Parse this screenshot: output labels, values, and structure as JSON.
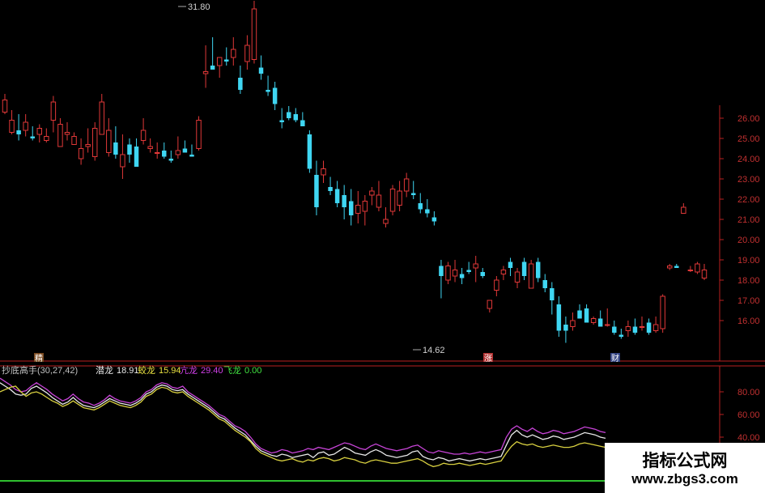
{
  "chart_data": [
    {
      "type": "candlestick",
      "y_range": [
        14.0,
        32.3
      ],
      "y_ticks": [
        "26.00",
        "25.00",
        "24.00",
        "23.00",
        "22.00",
        "21.00",
        "20.00",
        "19.00",
        "18.00",
        "17.00",
        "16.00"
      ],
      "markers": {
        "high": "31.80",
        "low": "14.62",
        "event_1": "精",
        "event_2": "涨",
        "event_3": "财"
      },
      "colors": {
        "up": "#e03838",
        "down": "#3fd6f2",
        "axis": "#b82020"
      },
      "candles": [
        [
          26.3,
          27.2,
          26.2,
          26.9
        ],
        [
          25.3,
          26.4,
          25.2,
          25.9
        ],
        [
          25.4,
          26.2,
          24.9,
          25.2
        ],
        [
          25.4,
          26.2,
          25.1,
          25.8
        ],
        [
          25.1,
          25.6,
          24.9,
          25.0
        ],
        [
          25.2,
          25.7,
          24.8,
          25.5
        ],
        [
          24.9,
          25.5,
          24.8,
          25.1
        ],
        [
          25.9,
          27.1,
          25.3,
          26.8
        ],
        [
          24.6,
          26.0,
          24.7,
          25.7
        ],
        [
          25.2,
          25.8,
          24.9,
          25.3
        ],
        [
          24.7,
          25.3,
          24.7,
          25.1
        ],
        [
          24.0,
          25.0,
          23.7,
          24.5
        ],
        [
          24.6,
          25.5,
          24.3,
          24.7
        ],
        [
          24.1,
          25.8,
          23.9,
          25.5
        ],
        [
          25.2,
          27.2,
          26.0,
          26.8
        ],
        [
          24.3,
          26.0,
          24.1,
          25.4
        ],
        [
          24.8,
          25.6,
          24.0,
          24.2
        ],
        [
          23.6,
          25.2,
          23.0,
          24.2
        ],
        [
          24.7,
          25.0,
          23.8,
          24.2
        ],
        [
          24.6,
          25.0,
          23.6,
          23.6
        ],
        [
          24.9,
          26.0,
          24.7,
          25.4
        ],
        [
          24.5,
          25.0,
          24.3,
          24.6
        ],
        [
          24.3,
          24.8,
          24.0,
          24.3
        ],
        [
          24.4,
          24.8,
          24.0,
          24.1
        ],
        [
          24.0,
          24.4,
          23.8,
          23.9
        ],
        [
          24.2,
          25.1,
          24.0,
          24.4
        ],
        [
          24.5,
          24.9,
          24.3,
          24.3
        ],
        [
          24.2,
          24.7,
          24.1,
          24.1
        ],
        [
          24.5,
          26.1,
          24.4,
          25.9
        ],
        [
          28.2,
          29.6,
          27.5,
          28.3
        ],
        [
          28.6,
          30.0,
          28.4,
          28.4
        ],
        [
          28.6,
          29.0,
          28.0,
          29.0
        ],
        [
          28.9,
          29.5,
          28.6,
          28.8
        ],
        [
          29.0,
          30.0,
          28.6,
          29.4
        ],
        [
          28.0,
          28.6,
          27.2,
          27.4
        ],
        [
          28.8,
          30.1,
          28.4,
          29.6
        ],
        [
          28.9,
          31.8,
          28.7,
          31.4
        ],
        [
          28.5,
          29.1,
          27.9,
          28.2
        ],
        [
          27.4,
          28.1,
          27.1,
          27.3
        ],
        [
          27.5,
          27.8,
          26.4,
          26.7
        ],
        [
          25.9,
          26.5,
          25.5,
          25.8
        ],
        [
          26.3,
          26.6,
          25.9,
          26.0
        ],
        [
          26.2,
          26.5,
          25.8,
          25.9
        ],
        [
          25.9,
          26.3,
          25.6,
          25.6
        ],
        [
          25.2,
          25.4,
          23.3,
          23.5
        ],
        [
          23.2,
          23.9,
          21.2,
          21.6
        ],
        [
          23.2,
          23.9,
          22.8,
          23.5
        ],
        [
          22.6,
          23.1,
          22.2,
          22.4
        ],
        [
          22.5,
          22.9,
          21.6,
          21.8
        ],
        [
          22.2,
          22.7,
          21.0,
          21.6
        ],
        [
          21.9,
          22.5,
          20.7,
          21.2
        ],
        [
          21.3,
          22.4,
          20.8,
          21.7
        ],
        [
          21.4,
          22.2,
          20.7,
          21.9
        ],
        [
          22.2,
          22.6,
          21.7,
          22.4
        ],
        [
          21.6,
          22.9,
          21.4,
          22.2
        ],
        [
          20.8,
          21.6,
          20.6,
          21.0
        ],
        [
          21.4,
          22.7,
          21.2,
          22.5
        ],
        [
          21.7,
          22.9,
          21.4,
          22.4
        ],
        [
          22.4,
          23.3,
          22.1,
          23.0
        ],
        [
          22.3,
          22.9,
          22.0,
          22.2
        ],
        [
          21.8,
          22.3,
          21.3,
          21.5
        ],
        [
          21.5,
          22.0,
          21.1,
          21.3
        ],
        [
          21.1,
          21.4,
          20.7,
          20.9
        ],
        [
          18.7,
          19.0,
          17.1,
          18.2
        ],
        [
          18.0,
          18.9,
          17.8,
          18.7
        ],
        [
          18.2,
          19.0,
          17.9,
          18.5
        ],
        [
          18.3,
          18.6,
          17.8,
          18.1
        ],
        [
          18.5,
          18.9,
          18.3,
          18.4
        ],
        [
          18.6,
          19.2,
          17.9,
          18.8
        ],
        [
          18.4,
          18.6,
          18.1,
          18.2
        ],
        [
          16.6,
          17.0,
          16.4,
          17.0
        ],
        [
          17.5,
          18.2,
          17.2,
          18.0
        ],
        [
          18.3,
          18.7,
          18.0,
          18.5
        ],
        [
          18.9,
          19.1,
          18.2,
          18.6
        ],
        [
          17.9,
          18.6,
          17.6,
          18.4
        ],
        [
          18.9,
          19.1,
          18.0,
          18.2
        ],
        [
          17.6,
          19.0,
          17.6,
          18.8
        ],
        [
          18.9,
          19.1,
          17.9,
          18.1
        ],
        [
          18.0,
          18.3,
          17.4,
          17.6
        ],
        [
          17.6,
          17.9,
          16.3,
          17.0
        ],
        [
          16.8,
          17.2,
          15.2,
          15.5
        ],
        [
          15.8,
          16.2,
          14.9,
          15.5
        ],
        [
          15.7,
          16.4,
          15.5,
          16.0
        ],
        [
          16.5,
          16.8,
          16.1,
          16.1
        ],
        [
          16.6,
          16.8,
          15.9,
          15.9
        ],
        [
          15.9,
          16.2,
          15.8,
          16.1
        ],
        [
          16.1,
          16.5,
          15.7,
          15.7
        ],
        [
          15.8,
          16.6,
          15.7,
          15.8
        ],
        [
          15.7,
          16.0,
          15.3,
          15.4
        ],
        [
          15.3,
          15.6,
          15.1,
          15.2
        ],
        [
          15.5,
          16.0,
          15.2,
          15.7
        ],
        [
          15.7,
          16.1,
          15.3,
          15.4
        ],
        [
          15.7,
          16.2,
          15.5,
          15.7
        ],
        [
          15.9,
          16.1,
          15.3,
          15.4
        ],
        [
          15.5,
          16.2,
          15.4,
          15.8
        ],
        [
          15.6,
          17.3,
          15.4,
          17.2
        ],
        [
          18.6,
          18.8,
          18.5,
          18.7
        ],
        [
          18.7,
          18.8,
          18.6,
          18.6
        ],
        [
          21.3,
          21.8,
          21.4,
          21.6
        ],
        [
          18.5,
          18.7,
          18.4,
          18.5
        ],
        [
          18.4,
          18.9,
          18.3,
          18.8
        ],
        [
          18.1,
          18.8,
          18.0,
          18.5
        ]
      ]
    },
    {
      "type": "line",
      "title": "抄底高手(30,27,42)",
      "ylim": [
        0,
        100
      ],
      "y_ticks": [
        "80.00",
        "60.00",
        "40.00"
      ],
      "legend": [
        {
          "name": "潜龙",
          "value": "18.91",
          "color": "#e8e8e8"
        },
        {
          "name": "蛟龙",
          "value": "15.94",
          "color": "#e8e040"
        },
        {
          "name": "亢龙",
          "value": "29.40",
          "color": "#d040e8"
        },
        {
          "name": "飞龙",
          "value": "0.00",
          "color": "#40e040"
        }
      ],
      "series": [
        {
          "name": "亢龙",
          "color": "#c844d8",
          "values": [
            92,
            89,
            86,
            82,
            80,
            81,
            85,
            88,
            85,
            82,
            78,
            75,
            72,
            74,
            78,
            74,
            71,
            70,
            68,
            70,
            73,
            77,
            74,
            72,
            71,
            70,
            72,
            75,
            80,
            82,
            86,
            88,
            87,
            84,
            83,
            85,
            80,
            77,
            74,
            71,
            68,
            64,
            60,
            58,
            54,
            50,
            48,
            45,
            40,
            34,
            30,
            28,
            26,
            27,
            29,
            28,
            26,
            27,
            28,
            30,
            29,
            31,
            30,
            29,
            31,
            33,
            35,
            34,
            32,
            30,
            29,
            32,
            34,
            32,
            30,
            29,
            28,
            29,
            30,
            32,
            33,
            30,
            27,
            26,
            28,
            27,
            26,
            25,
            25,
            26,
            25,
            26,
            27,
            26,
            27,
            28,
            29,
            40,
            47,
            50,
            47,
            45,
            48,
            45,
            43,
            44,
            46,
            45,
            43,
            44,
            45,
            47,
            49,
            48,
            47,
            45,
            44
          ]
        },
        {
          "name": "潜龙",
          "color": "#e8e8e8",
          "values": [
            88,
            85,
            82,
            78,
            77,
            78,
            83,
            85,
            82,
            79,
            75,
            72,
            69,
            71,
            75,
            71,
            68,
            67,
            66,
            68,
            71,
            74,
            72,
            70,
            69,
            68,
            70,
            73,
            78,
            80,
            84,
            86,
            85,
            82,
            81,
            82,
            78,
            75,
            72,
            69,
            66,
            62,
            58,
            56,
            52,
            48,
            45,
            42,
            37,
            32,
            28,
            26,
            24,
            23,
            25,
            24,
            22,
            23,
            24,
            25,
            22,
            26,
            27,
            24,
            25,
            28,
            31,
            29,
            26,
            25,
            24,
            27,
            29,
            27,
            24,
            23,
            22,
            23,
            24,
            27,
            28,
            23,
            21,
            20,
            22,
            21,
            19,
            20,
            21,
            20,
            19,
            20,
            21,
            20,
            21,
            22,
            23,
            33,
            42,
            46,
            42,
            40,
            42,
            40,
            38,
            39,
            41,
            40,
            38,
            39,
            40,
            42,
            44,
            43,
            42,
            40,
            39
          ]
        },
        {
          "name": "蛟龙",
          "color": "#d8d040",
          "values": [
            80,
            82,
            84,
            85,
            80,
            76,
            79,
            80,
            78,
            75,
            72,
            70,
            67,
            69,
            72,
            69,
            66,
            65,
            64,
            66,
            69,
            72,
            70,
            68,
            67,
            66,
            68,
            71,
            76,
            78,
            82,
            84,
            83,
            80,
            79,
            80,
            76,
            73,
            70,
            67,
            64,
            60,
            56,
            54,
            50,
            46,
            43,
            40,
            36,
            30,
            26,
            24,
            22,
            20,
            19,
            20,
            21,
            19,
            18,
            20,
            19,
            21,
            22,
            21,
            19,
            20,
            22,
            21,
            20,
            18,
            17,
            19,
            20,
            19,
            18,
            17,
            17,
            18,
            19,
            20,
            21,
            19,
            16,
            14,
            15,
            17,
            16,
            16,
            17,
            16,
            15,
            16,
            17,
            16,
            17,
            18,
            19,
            26,
            32,
            36,
            34,
            33,
            34,
            32,
            31,
            32,
            33,
            32,
            31,
            31,
            32,
            34,
            35,
            34,
            33,
            32,
            31
          ]
        }
      ]
    }
  ],
  "watermark": {
    "title": "指标公式网",
    "url": "www.zbgs3.com"
  }
}
